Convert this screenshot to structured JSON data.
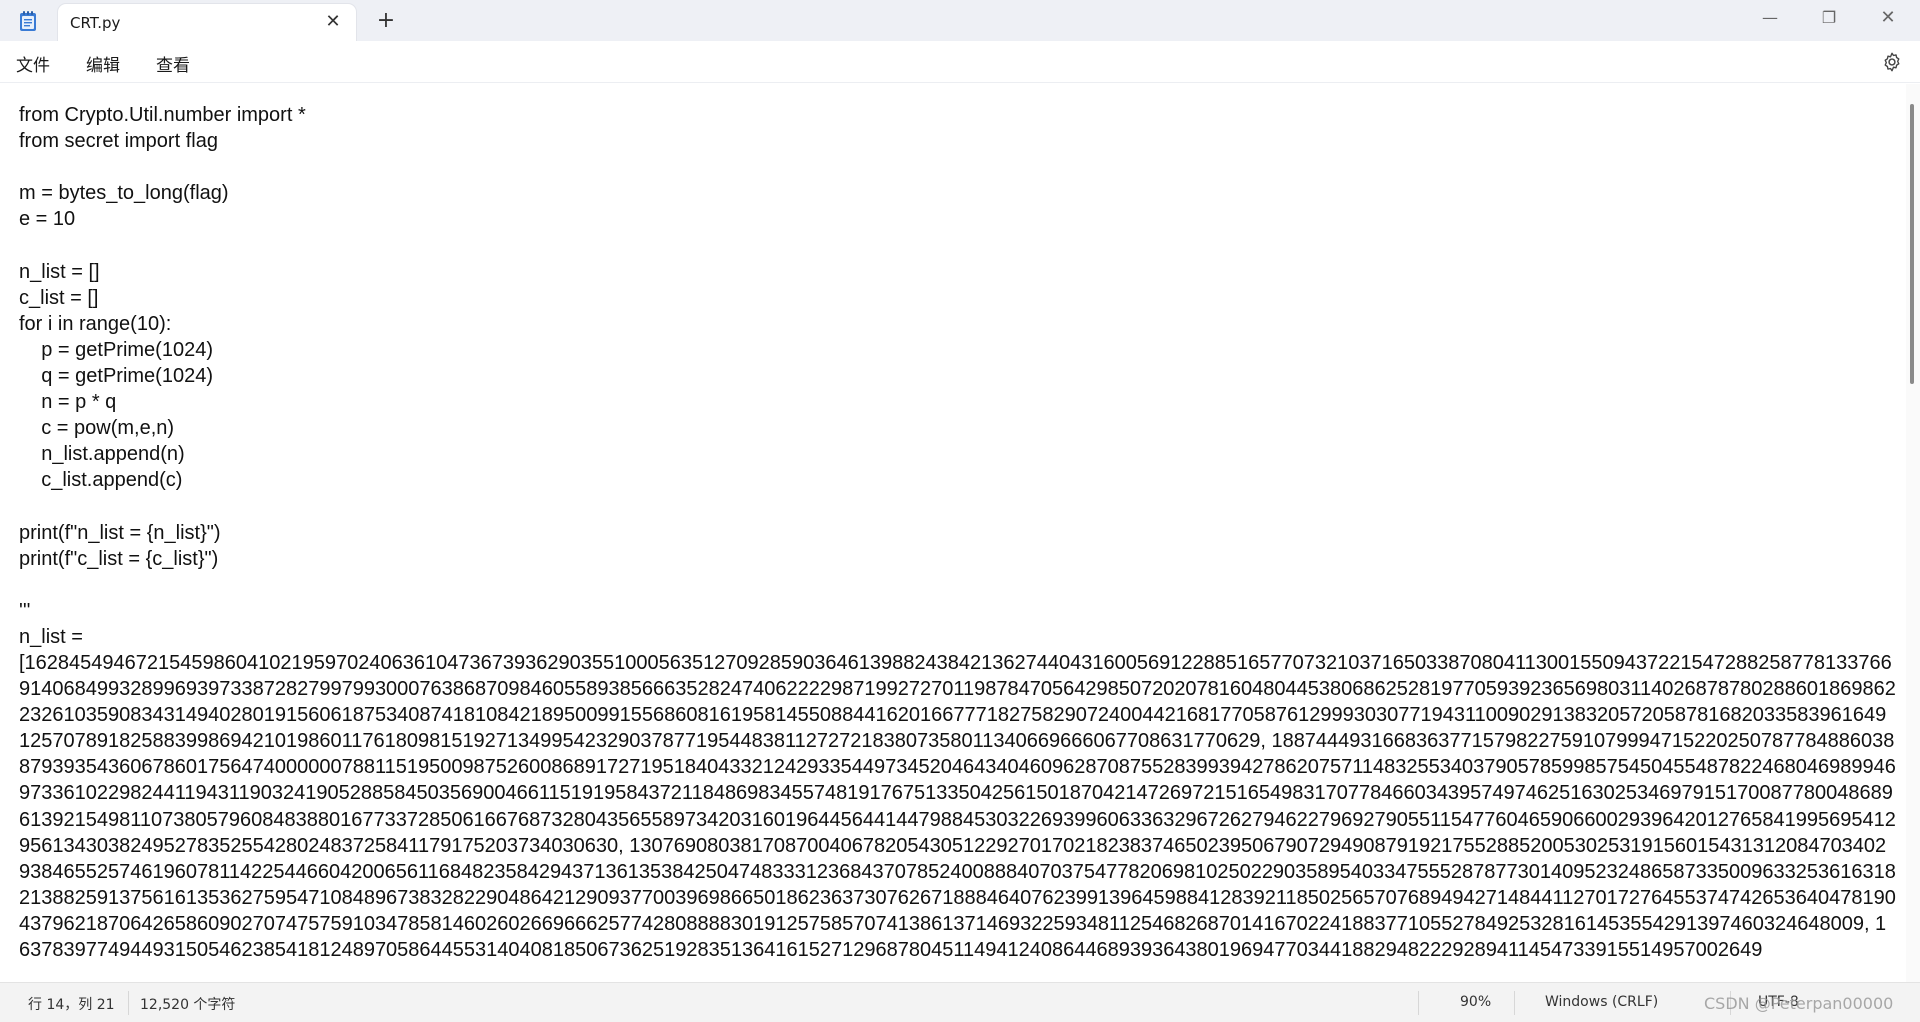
{
  "tab": {
    "title": "CRT.py",
    "close_glyph": "✕",
    "new_tab_glyph": "+"
  },
  "window": {
    "minimize_glyph": "—",
    "maximize_glyph": "❐",
    "close_glyph": "✕"
  },
  "menu": {
    "file": "文件",
    "edit": "编辑",
    "view": "查看"
  },
  "icons": {
    "app": "notepad-icon",
    "settings": "gear-icon"
  },
  "code_lines": [
    "from Crypto.Util.number import *",
    "from secret import flag",
    "",
    "m = bytes_to_long(flag)",
    "e = 10",
    "",
    "n_list = []",
    "c_list = []",
    "for i in range(10):",
    "    p = getPrime(1024)",
    "    q = getPrime(1024)",
    "    n = p * q",
    "    c = pow(m,e,n)",
    "    n_list.append(n)",
    "    c_list.append(c)",
    "",
    "print(f\"n_list = {n_list}\")",
    "print(f\"c_list = {c_list}\")",
    "",
    "'''",
    "n_list =",
    "[16284549467215459860410219597024063610473673936290355100056351270928590364613988243842136274404316005691228851657707321037165033870804113001550943722154728825877813376691406849932899693973387282799799300076386870984605589385666352824740622229871992727011987847056429850720207816048044538068625281977059392365698031140268787802886018698622326103590834314940280191560618753408741810842189500991556860816195814550884416201667771827582907240044216817705876129993030771943110090291383205720587816820335839616491257078918258839986942101986011761809815192713499542329037877195448381127272183807358011340669666067708631770629, 18874449316683637715798227591079994715220250787784886038879393543606786017564740000007881151950098752600868917271951840433212429335449734520464340460962870875528399394278620757114832553403790578599857545045548782246804698994697336102298244119431190324190528858450356900466115191958437211848698345574819176751335042561501870421472697215165498317077846603439574974625163025346979151700877800486896139215498110738057960848388016773372850616676873280435655897342031601964456441447988453032269399606336329672627946227969279055115477604659066002939642012765841995695412956134303824952783525542802483725841179175203734030630, 13076908038170870040678205430512292701702182383746502395067907294908791921755288520053025319156015431312084703402938465525746196078114225446604200656116848235842943713613538425047483331236843707852400888407037547782069810250229035895403347555287877301409523248658733500963325361631821388259137561613536275954710848967383282290486421290937700396986650186236373076267188846407623991396459884128392118502565707689494271484411270172764553747426536404781904379621870642658609027074757591034785814602602669666257742808888301912575857074138613714693225934811254682687014167022418837710552784925328161453554291397460324648009, 16378397749449315054623854181248970586445531404081850673625192835136416152712968780451149412408644689393643801969477034418829482229289411454733915514957002649"
  ],
  "status": {
    "position": "行 14，列 21",
    "char_count": "12,520 个字符",
    "zoom": "90%",
    "line_ending": "Windows (CRLF)",
    "encoding": "UTF-8"
  },
  "watermark": "CSDN @Peterpan00000"
}
